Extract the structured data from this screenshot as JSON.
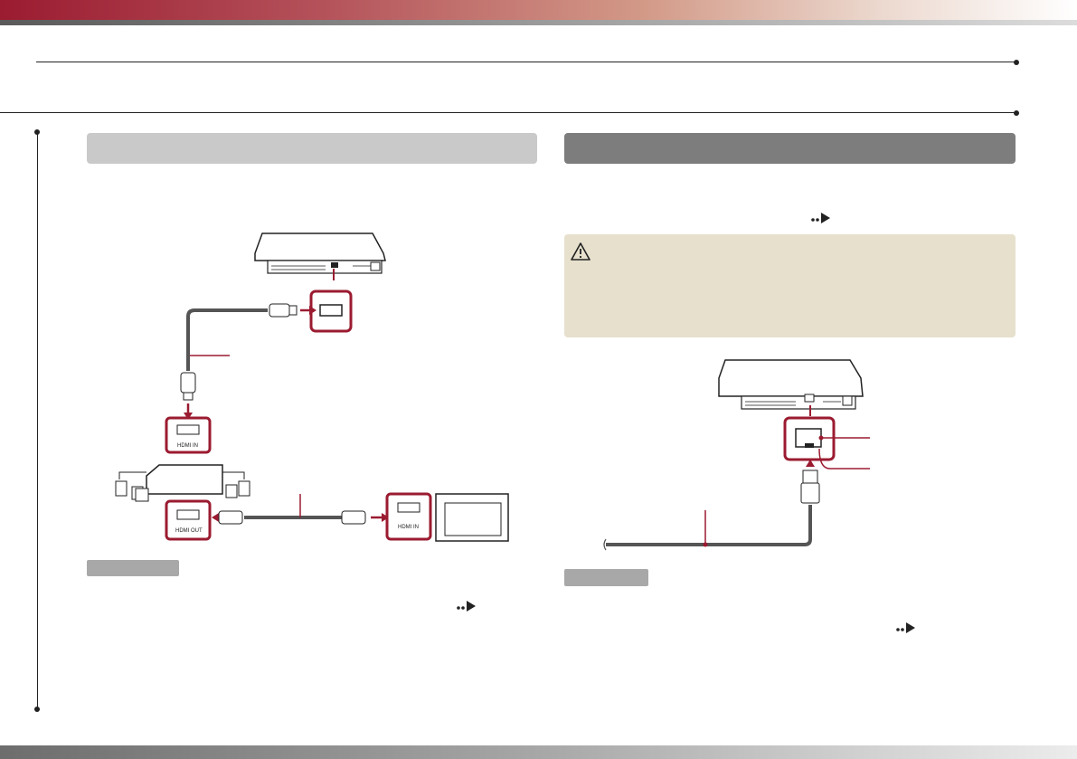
{
  "page": {
    "brand_colors": {
      "accent": "#9b1b30",
      "band_gray": "#7d7d7d",
      "caution_bg": "#e6e0cd",
      "connector_red": "#9b1b30"
    }
  },
  "left_section": {
    "heading": "",
    "hint_label": ""
  },
  "right_section": {
    "heading": "",
    "caution_icon": "warning-triangle-icon",
    "hint_label": ""
  },
  "left_diagram": {
    "connector_labels": {
      "hdmi_in": "HDMI IN",
      "hdmi_out": "HDMI OUT",
      "tv_hdmi_in": "HDMI IN"
    }
  },
  "icons": {
    "reference": "double-dot-arrow-icon"
  }
}
